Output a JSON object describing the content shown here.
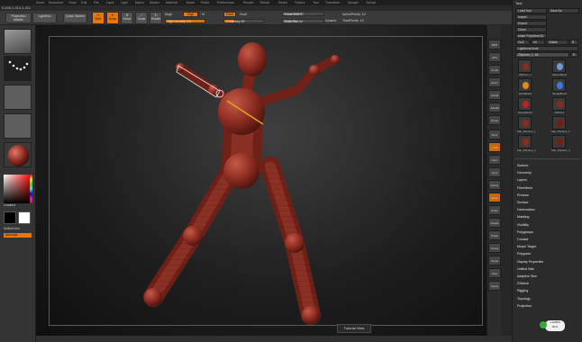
{
  "app": {
    "coords_readout": "0.406,1.414,1.411",
    "menus": [
      "Zoom",
      "Document",
      "Draw",
      "Edit",
      "File",
      "Layer",
      "Light",
      "Macro",
      "Marker",
      "Material",
      "Movie",
      "Picker",
      "Preferences",
      "Render",
      "Stencil",
      "Stroke",
      "Texture",
      "Tool",
      "Transform",
      "Zplugin",
      "Zscript"
    ]
  },
  "toolbar": {
    "projection_master": "Projection Master",
    "lightbox": "LightBox",
    "quick_sketch": "Quick Sketch",
    "edit": "Edit",
    "draw": "Draw",
    "move": "Move",
    "scale": "Scale",
    "rotate": "Rotate",
    "mrgb": "Mrgb",
    "rgb": "Rgb",
    "m": "M",
    "rgb_intensity": "Rgb Intensity 100",
    "zadd": "Zadd",
    "zsub": "Zsub",
    "z_intensity": "Z Intensity 25",
    "focal_shift": "Focal Shift 0",
    "draw_size": "Draw Size 64",
    "dynamic": "Dynamic",
    "active_points": "ActivePoints: 10",
    "total_points": "TotalPoints: 10",
    "rgb_intensity_level": 1.0,
    "z_intensity_level": 0.25,
    "focal_shift_level": 0.5,
    "draw_size_level": 0.35
  },
  "left_tray": {
    "gradient_label": "Gradient",
    "switch_color_label": "SwitchColor",
    "alternate_label": "Alternate"
  },
  "viewport": {
    "tutorial_label": "Tutorial View"
  },
  "shelf": {
    "items": [
      "BPR",
      "SPix",
      "Scroll",
      "Zoom",
      "Actual",
      "AAHalf",
      "Persp",
      "Floor",
      "Local",
      "LSym",
      "Gxyz",
      "Frame",
      "Move",
      "Scale",
      "Rotate",
      "PolyF",
      "Transp",
      "Ghost",
      "Solo",
      "Xpose"
    ]
  },
  "tool_panel": {
    "title": "Tool",
    "load_tool": "Load Tool",
    "save_as": "Save As",
    "import": "Import",
    "export": "Export",
    "clone": "Clone",
    "make_polymesh3d": "Make PolyMesh3D",
    "goz": "GoZ",
    "all": "All",
    "visible": "Visible",
    "r": "R",
    "lightbox_tools": "Lightbox▸Tools",
    "current_tool": "ZSphere_1. 48",
    "r_label": "R",
    "tools": [
      {
        "name": "ZSphere_1"
      },
      {
        "name": "SphereBrush"
      },
      {
        "name": "AlphaBrush"
      },
      {
        "name": "SimpleBrush"
      },
      {
        "name": "EraserBrush"
      },
      {
        "name": "ZSphere"
      },
      {
        "name": "Star_ZSphere_1"
      },
      {
        "name": "Star_ZSphere_2"
      },
      {
        "name": "Star_ZSphere_3"
      },
      {
        "name": "Star_ZSphere_4"
      }
    ],
    "subpalettes": [
      "Subtool",
      "Geometry",
      "Layers",
      "FiberMesh",
      "Preview",
      "Surface",
      "Deformation",
      "Masking",
      "Visibility",
      "Polygroups",
      "Contact",
      "Morph Target",
      "Polypaint",
      "Display Properties",
      "Unified Skin",
      "Adaptive Skin",
      "ZSketch",
      "Rigging",
      "Topology",
      "Projection"
    ]
  },
  "status_badge": {
    "line1": "1.1MB/S",
    "line2": "0K/S"
  },
  "colors": {
    "accent": "#e8760a",
    "model": "#8b2b20",
    "panel": "#2b2b2b"
  }
}
